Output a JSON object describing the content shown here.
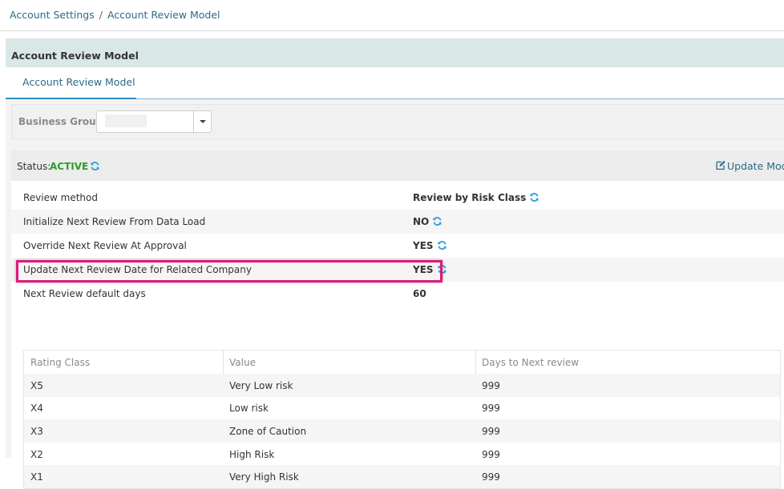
{
  "breadcrumb": {
    "root": "Account Settings",
    "separator": "/",
    "current": "Account Review Model"
  },
  "panel": {
    "title": "Account Review Model",
    "tab": "Account Review Model"
  },
  "business_group": {
    "label": "Business Group:",
    "value": ""
  },
  "status": {
    "label": "Status:",
    "value": "ACTIVE",
    "update_link": "Update Mode"
  },
  "settings": [
    {
      "label": "Review method",
      "value": "Review by Risk Class"
    },
    {
      "label": "Initialize Next Review From Data Load",
      "value": "NO"
    },
    {
      "label": "Override Next Review At Approval",
      "value": "YES"
    },
    {
      "label": "Update Next Review Date for Related Company",
      "value": "YES"
    },
    {
      "label": "Next Review default days",
      "value": "60"
    }
  ],
  "rating_table": {
    "headers": [
      "Rating Class",
      "Value",
      "Days to Next review"
    ],
    "rows": [
      [
        "X5",
        "Very Low risk",
        "999"
      ],
      [
        "X4",
        "Low risk",
        "999"
      ],
      [
        "X3",
        "Zone of Caution",
        "999"
      ],
      [
        "X2",
        "High Risk",
        "999"
      ],
      [
        "X1",
        "Very High Risk",
        "999"
      ]
    ]
  },
  "colors": {
    "active_status": "#2e9b2e",
    "highlight_border": "#e0197a",
    "link": "#2b6b87",
    "refresh_icon": "#2e9ed6"
  }
}
